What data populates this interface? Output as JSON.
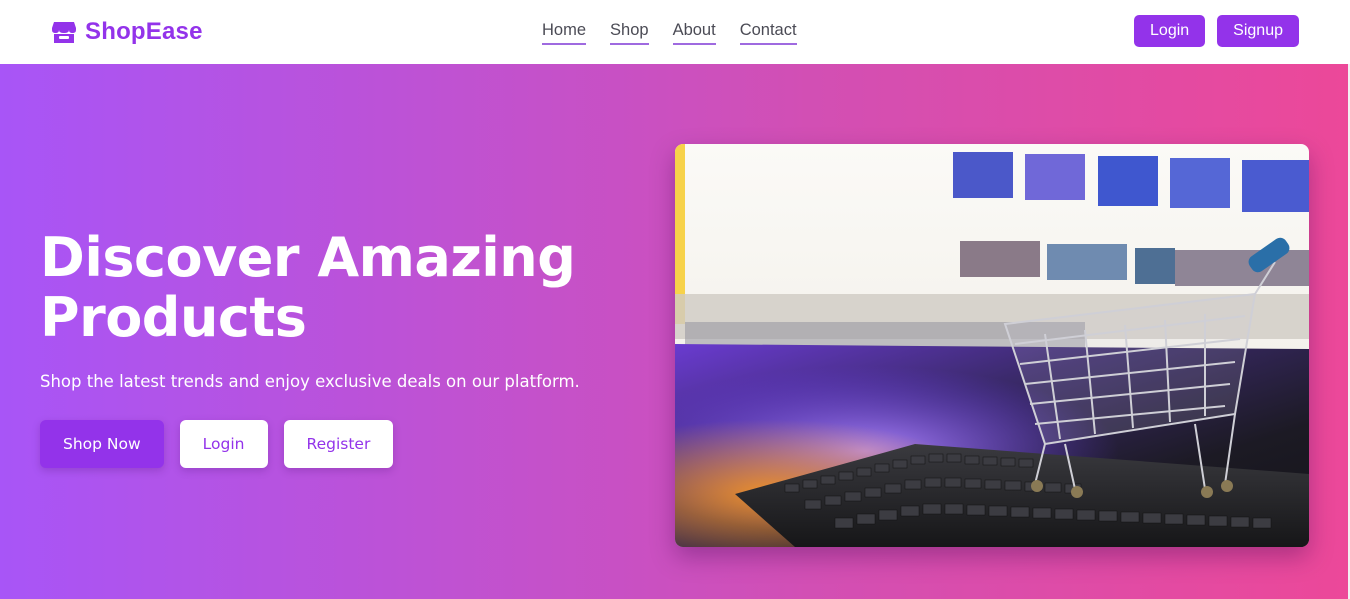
{
  "brand": {
    "name": "ShopEase",
    "icon": "store-icon",
    "color": "#9333ea"
  },
  "nav": {
    "items": [
      {
        "label": "Home"
      },
      {
        "label": "Shop"
      },
      {
        "label": "About"
      },
      {
        "label": "Contact"
      }
    ]
  },
  "auth": {
    "login_label": "Login",
    "signup_label": "Signup"
  },
  "hero": {
    "title_line1": "Discover Amazing",
    "title_line2": "Products",
    "subtitle": "Shop the latest trends and enjoy exclusive deals on our platform.",
    "buttons": {
      "shop_now": "Shop Now",
      "login": "Login",
      "register": "Register"
    },
    "image": {
      "subject": "shopping cart on keyboard in front of monitor"
    },
    "gradient": [
      "#a855f7",
      "#ec4899"
    ]
  }
}
